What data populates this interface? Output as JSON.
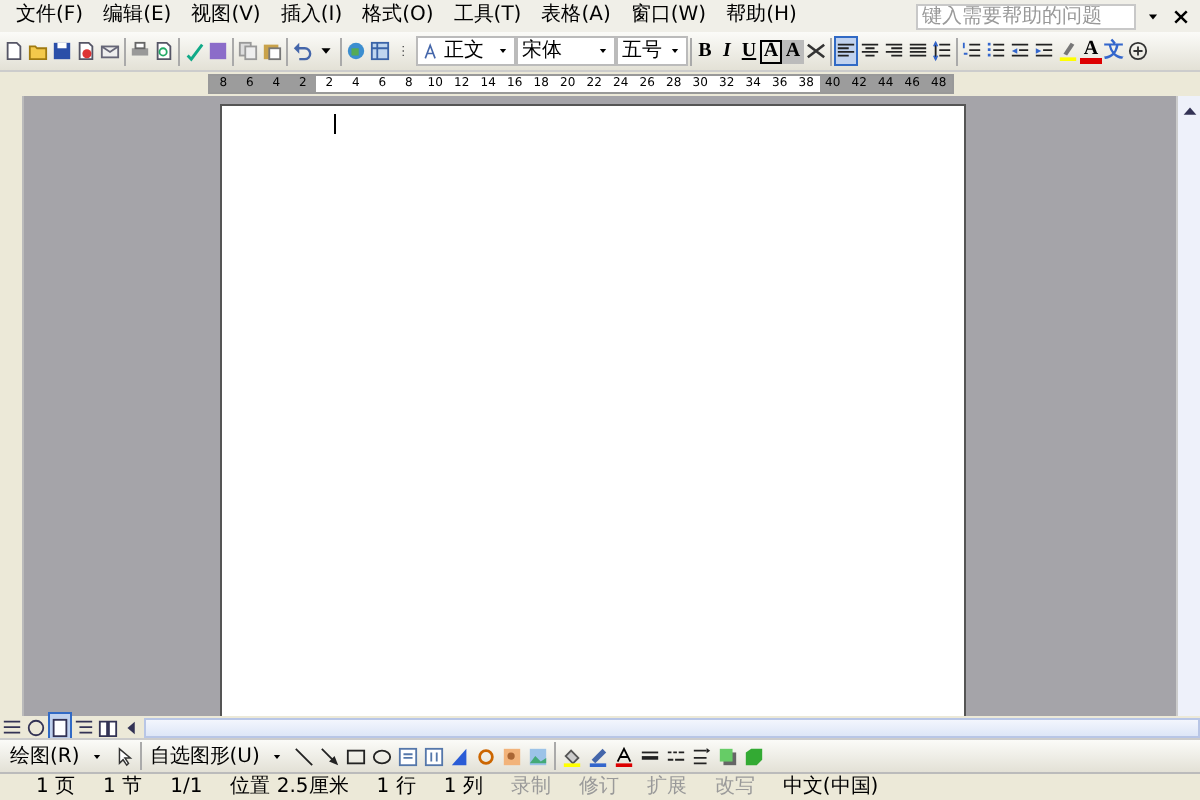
{
  "menu_bar": {
    "items": [
      "文件(F)",
      "编辑(E)",
      "视图(V)",
      "插入(I)",
      "格式(O)",
      "工具(T)",
      "表格(A)",
      "窗口(W)",
      "帮助(H)"
    ],
    "help_box": {
      "placeholder": "键入需要帮助的问题"
    }
  },
  "formatting_toolbar": {
    "style": "正文",
    "font": "宋体",
    "size": "五号",
    "bold": "B",
    "italic": "I",
    "underline": "U",
    "char_border": "A",
    "char_shading": "A",
    "font_color": "A",
    "phonetic": "文",
    "alignments": [
      {
        "selected": true
      },
      {
        "selected": false
      },
      {
        "selected": false
      },
      {
        "selected": false
      }
    ]
  },
  "ruler": {
    "labels": [
      "8",
      "6",
      "4",
      "2",
      "2",
      "4",
      "6",
      "8",
      "10",
      "12",
      "14",
      "16",
      "18",
      "20",
      "22",
      "24",
      "26",
      "28",
      "30",
      "32",
      "34",
      "36",
      "38",
      "40",
      "42",
      "44",
      "46",
      "48"
    ]
  },
  "view_buttons": [
    {
      "selected": false
    },
    {
      "selected": false
    },
    {
      "selected": true
    },
    {
      "selected": false
    },
    {
      "selected": false
    }
  ],
  "drawing_toolbar": {
    "draw": "绘图(R)",
    "autoshapes": "自选图形(U)"
  },
  "status_bar": [
    {
      "text": "1 页",
      "enabled": true
    },
    {
      "text": "1 节",
      "enabled": true
    },
    {
      "text": "1/1",
      "enabled": true
    },
    {
      "text": "位置 2.5厘米",
      "enabled": true
    },
    {
      "text": "1 行",
      "enabled": true
    },
    {
      "text": "1 列",
      "enabled": true
    },
    {
      "text": "录制",
      "enabled": false
    },
    {
      "text": "修订",
      "enabled": false
    },
    {
      "text": "扩展",
      "enabled": false
    },
    {
      "text": "改写",
      "enabled": false
    },
    {
      "text": "中文(中国)",
      "enabled": true
    }
  ]
}
